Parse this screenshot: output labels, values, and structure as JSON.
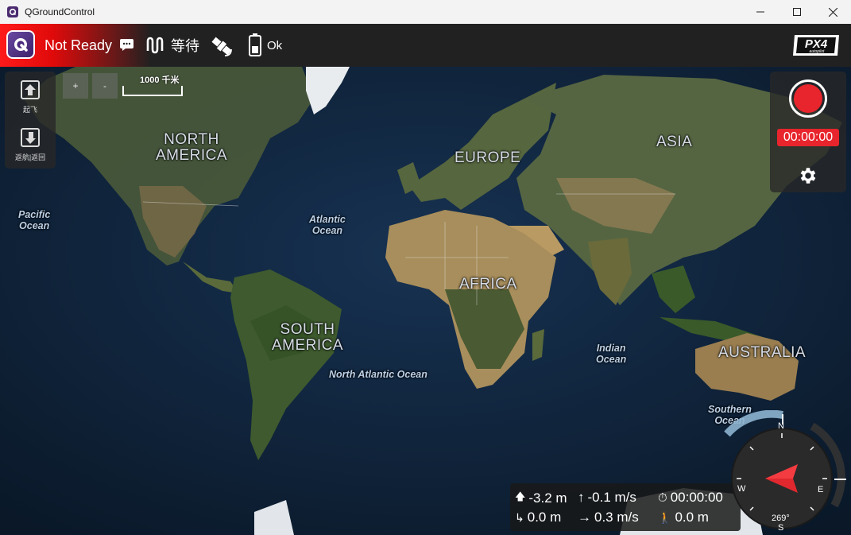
{
  "window": {
    "title": "QGroundControl",
    "minimize_icon": "minimize-icon",
    "maximize_icon": "maximize-icon",
    "close_icon": "close-icon"
  },
  "toolbar": {
    "status": "Not Ready",
    "gps_status": "等待",
    "battery_status": "Ok",
    "icons": [
      "qgc-logo-icon",
      "message-icon",
      "rc-signal-icon",
      "satellite-icon",
      "battery-icon",
      "px4-autopilot-logo"
    ]
  },
  "left_panel": {
    "takeoff_label": "起飞",
    "rtl_label": "返航|返回"
  },
  "map_controls": {
    "zoom_in": "+",
    "zoom_out": "-",
    "scale_label": "1000 千米"
  },
  "map_labels": {
    "north_america": "NORTH\nAMERICA",
    "south_america": "SOUTH\nAMERICA",
    "europe": "EUROPE",
    "asia": "ASIA",
    "africa": "AFRICA",
    "australia": "AUSTRALIA",
    "pacific_ocean": "Pacific\nOcean",
    "atlantic_ocean": "Atlantic\nOcean",
    "north_atlantic_ocean": "North Atlantic Ocean",
    "indian_ocean": "Indian\nOcean",
    "southern_ocean": "Southern\nOcean"
  },
  "right_panel": {
    "record_timer": "00:00:00",
    "settings_icon": "gear-icon"
  },
  "telemetry": {
    "altitude_relative": "-3.2 m",
    "vertical_speed": "-0.1 m/s",
    "flight_time": "00:00:00",
    "distance_home": "0.0 m",
    "ground_speed": "0.3 m/s",
    "distance_traveled": "0.0 m"
  },
  "compass": {
    "north": "N",
    "south": "S",
    "east": "E",
    "west": "W",
    "heading": "269°"
  },
  "colors": {
    "toolbar_bg": "#212121",
    "status_red": "#ff1a1a",
    "record_red": "#e8252c",
    "compass_arrow": "#e0282e"
  }
}
